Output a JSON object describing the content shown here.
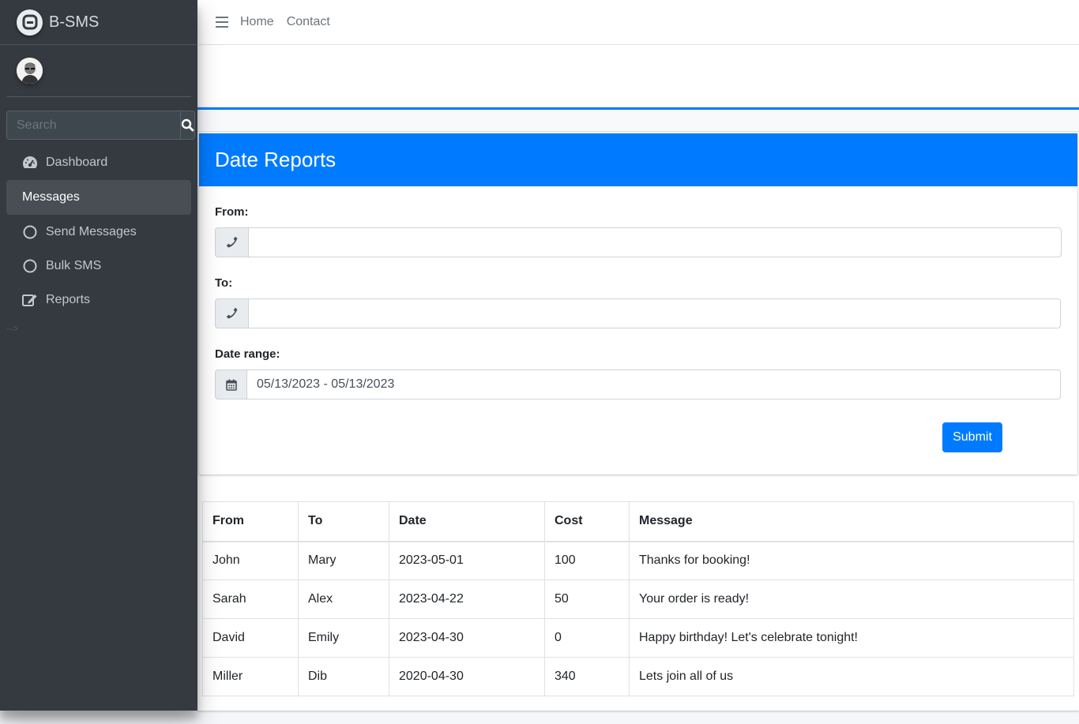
{
  "brand": {
    "name": "B-SMS"
  },
  "sidebar": {
    "search_placeholder": "Search",
    "items": [
      {
        "label": "Dashboard",
        "icon": "dashboard-gauge-icon"
      },
      {
        "label": "Messages",
        "icon": ""
      },
      {
        "label": "Send Messages",
        "icon": "circle-icon"
      },
      {
        "label": "Bulk SMS",
        "icon": "circle-icon"
      },
      {
        "label": "Reports",
        "icon": "edit-icon"
      }
    ],
    "stray_text": "-->"
  },
  "navbar": {
    "links": [
      "Home",
      "Contact"
    ]
  },
  "form": {
    "title": "Date Reports",
    "from_label": "From:",
    "from_value": "",
    "to_label": "To:",
    "to_value": "",
    "date_label": "Date range:",
    "date_value": "05/13/2023 - 05/13/2023",
    "submit_label": "Submit"
  },
  "table": {
    "headers": [
      "From",
      "To",
      "Date",
      "Cost",
      "Message"
    ],
    "rows": [
      [
        "John",
        "Mary",
        "2023-05-01",
        "100",
        "Thanks for booking!"
      ],
      [
        "Sarah",
        "Alex",
        "2023-04-22",
        "50",
        "Your order is ready!"
      ],
      [
        "David",
        "Emily",
        "2023-04-30",
        "0",
        "Happy birthday! Let's celebrate tonight!"
      ],
      [
        "Miller",
        "Dib",
        "2020-04-30",
        "340",
        "Lets join all of us"
      ]
    ]
  },
  "colors": {
    "sidebar_bg": "#343a40",
    "primary": "#007bff",
    "content_bg": "#f4f6f9"
  }
}
